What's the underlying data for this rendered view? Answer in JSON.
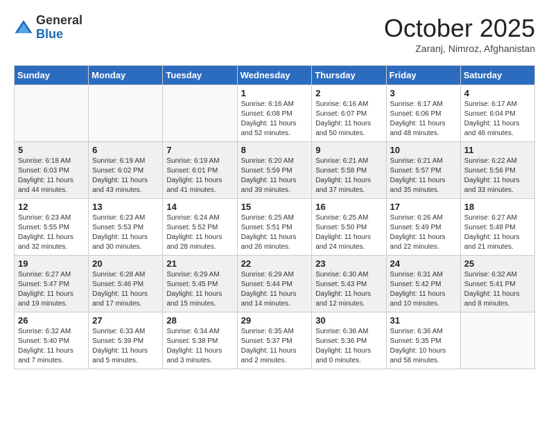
{
  "header": {
    "logo_general": "General",
    "logo_blue": "Blue",
    "month_title": "October 2025",
    "location": "Zaranj, Nimroz, Afghanistan"
  },
  "days_of_week": [
    "Sunday",
    "Monday",
    "Tuesday",
    "Wednesday",
    "Thursday",
    "Friday",
    "Saturday"
  ],
  "weeks": [
    [
      {
        "day": "",
        "text": ""
      },
      {
        "day": "",
        "text": ""
      },
      {
        "day": "",
        "text": ""
      },
      {
        "day": "1",
        "text": "Sunrise: 6:16 AM\nSunset: 6:08 PM\nDaylight: 11 hours\nand 52 minutes."
      },
      {
        "day": "2",
        "text": "Sunrise: 6:16 AM\nSunset: 6:07 PM\nDaylight: 11 hours\nand 50 minutes."
      },
      {
        "day": "3",
        "text": "Sunrise: 6:17 AM\nSunset: 6:06 PM\nDaylight: 11 hours\nand 48 minutes."
      },
      {
        "day": "4",
        "text": "Sunrise: 6:17 AM\nSunset: 6:04 PM\nDaylight: 11 hours\nand 46 minutes."
      }
    ],
    [
      {
        "day": "5",
        "text": "Sunrise: 6:18 AM\nSunset: 6:03 PM\nDaylight: 11 hours\nand 44 minutes."
      },
      {
        "day": "6",
        "text": "Sunrise: 6:19 AM\nSunset: 6:02 PM\nDaylight: 11 hours\nand 43 minutes."
      },
      {
        "day": "7",
        "text": "Sunrise: 6:19 AM\nSunset: 6:01 PM\nDaylight: 11 hours\nand 41 minutes."
      },
      {
        "day": "8",
        "text": "Sunrise: 6:20 AM\nSunset: 5:59 PM\nDaylight: 11 hours\nand 39 minutes."
      },
      {
        "day": "9",
        "text": "Sunrise: 6:21 AM\nSunset: 5:58 PM\nDaylight: 11 hours\nand 37 minutes."
      },
      {
        "day": "10",
        "text": "Sunrise: 6:21 AM\nSunset: 5:57 PM\nDaylight: 11 hours\nand 35 minutes."
      },
      {
        "day": "11",
        "text": "Sunrise: 6:22 AM\nSunset: 5:56 PM\nDaylight: 11 hours\nand 33 minutes."
      }
    ],
    [
      {
        "day": "12",
        "text": "Sunrise: 6:23 AM\nSunset: 5:55 PM\nDaylight: 11 hours\nand 32 minutes."
      },
      {
        "day": "13",
        "text": "Sunrise: 6:23 AM\nSunset: 5:53 PM\nDaylight: 11 hours\nand 30 minutes."
      },
      {
        "day": "14",
        "text": "Sunrise: 6:24 AM\nSunset: 5:52 PM\nDaylight: 11 hours\nand 28 minutes."
      },
      {
        "day": "15",
        "text": "Sunrise: 6:25 AM\nSunset: 5:51 PM\nDaylight: 11 hours\nand 26 minutes."
      },
      {
        "day": "16",
        "text": "Sunrise: 6:25 AM\nSunset: 5:50 PM\nDaylight: 11 hours\nand 24 minutes."
      },
      {
        "day": "17",
        "text": "Sunrise: 6:26 AM\nSunset: 5:49 PM\nDaylight: 11 hours\nand 22 minutes."
      },
      {
        "day": "18",
        "text": "Sunrise: 6:27 AM\nSunset: 5:48 PM\nDaylight: 11 hours\nand 21 minutes."
      }
    ],
    [
      {
        "day": "19",
        "text": "Sunrise: 6:27 AM\nSunset: 5:47 PM\nDaylight: 11 hours\nand 19 minutes."
      },
      {
        "day": "20",
        "text": "Sunrise: 6:28 AM\nSunset: 5:46 PM\nDaylight: 11 hours\nand 17 minutes."
      },
      {
        "day": "21",
        "text": "Sunrise: 6:29 AM\nSunset: 5:45 PM\nDaylight: 11 hours\nand 15 minutes."
      },
      {
        "day": "22",
        "text": "Sunrise: 6:29 AM\nSunset: 5:44 PM\nDaylight: 11 hours\nand 14 minutes."
      },
      {
        "day": "23",
        "text": "Sunrise: 6:30 AM\nSunset: 5:43 PM\nDaylight: 11 hours\nand 12 minutes."
      },
      {
        "day": "24",
        "text": "Sunrise: 6:31 AM\nSunset: 5:42 PM\nDaylight: 11 hours\nand 10 minutes."
      },
      {
        "day": "25",
        "text": "Sunrise: 6:32 AM\nSunset: 5:41 PM\nDaylight: 11 hours\nand 8 minutes."
      }
    ],
    [
      {
        "day": "26",
        "text": "Sunrise: 6:32 AM\nSunset: 5:40 PM\nDaylight: 11 hours\nand 7 minutes."
      },
      {
        "day": "27",
        "text": "Sunrise: 6:33 AM\nSunset: 5:39 PM\nDaylight: 11 hours\nand 5 minutes."
      },
      {
        "day": "28",
        "text": "Sunrise: 6:34 AM\nSunset: 5:38 PM\nDaylight: 11 hours\nand 3 minutes."
      },
      {
        "day": "29",
        "text": "Sunrise: 6:35 AM\nSunset: 5:37 PM\nDaylight: 11 hours\nand 2 minutes."
      },
      {
        "day": "30",
        "text": "Sunrise: 6:36 AM\nSunset: 5:36 PM\nDaylight: 11 hours\nand 0 minutes."
      },
      {
        "day": "31",
        "text": "Sunrise: 6:36 AM\nSunset: 5:35 PM\nDaylight: 10 hours\nand 58 minutes."
      },
      {
        "day": "",
        "text": ""
      }
    ]
  ]
}
